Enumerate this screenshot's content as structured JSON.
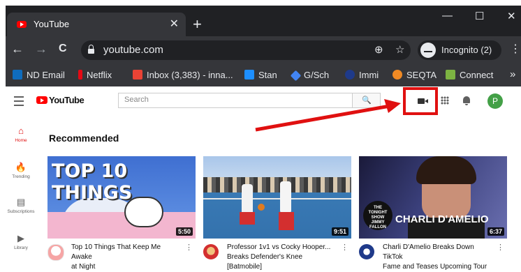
{
  "browser": {
    "tab_title": "YouTube",
    "tab_close": "✕",
    "new_tab": "+",
    "window_controls": {
      "minimize": "—",
      "maximize": "☐",
      "close": "✕"
    },
    "nav": {
      "back": "←",
      "forward": "→",
      "reload": "C"
    },
    "url": "youtube.com",
    "omnibox_icons": {
      "zoom": "⊕",
      "star": "☆"
    },
    "profile_label": "Incognito (2)",
    "menu": "⋮",
    "bookmarks": [
      {
        "label": "ND Email",
        "icon": "outlook-icon",
        "color": "#0f6cbd"
      },
      {
        "label": "Netflix",
        "icon": "netflix-icon",
        "color": "#e50914"
      },
      {
        "label": "Inbox (3,383) - inna...",
        "icon": "gmail-icon",
        "color": "#ea4335"
      },
      {
        "label": "Stan",
        "icon": "stan-icon",
        "color": "#1d8fff"
      },
      {
        "label": "G/Sch",
        "icon": "scholar-icon",
        "color": "#4285f4"
      },
      {
        "label": "Immi",
        "icon": "immi-icon",
        "color": "#1e3a8a"
      },
      {
        "label": "SEQTA",
        "icon": "seqta-icon",
        "color": "#f08a24"
      },
      {
        "label": "Connect",
        "icon": "connect-icon",
        "color": "#7cb342"
      }
    ],
    "bookmarks_overflow": "»"
  },
  "youtube": {
    "logo_text": "YouTube",
    "search_placeholder": "Search",
    "search_button": "🔍",
    "avatar_letter": "P",
    "sidebar": [
      {
        "label": "Home",
        "icon": "⌂"
      },
      {
        "label": "Trending",
        "icon": "🔥"
      },
      {
        "label": "Subscriptions",
        "icon": "▤"
      },
      {
        "label": "Library",
        "icon": "▶"
      }
    ],
    "section_title": "Recommended",
    "videos": [
      {
        "thumb_text": "TOP 10 THINGS",
        "duration": "5:50",
        "title_line1": "Top 10 Things That Keep Me Awake",
        "title_line2": "at Night"
      },
      {
        "thumb_text": "",
        "duration": "9:51",
        "title_line1": "Professor 1v1 vs Cocky Hooper...",
        "title_line2": "Breaks Defender's Knee [Batmobile]"
      },
      {
        "thumb_text": "CHARLI D'AMELIO",
        "thumb_sub": "THE TONIGHT SHOW JIMMY FALLON",
        "duration": "6:37",
        "title_line1": "Charli D'Amelio Breaks Down TikTok",
        "title_line2": "Fame and Teases Upcoming Tour"
      }
    ],
    "colors": {
      "accent": "#e01010",
      "avatar": "#43a047"
    }
  }
}
